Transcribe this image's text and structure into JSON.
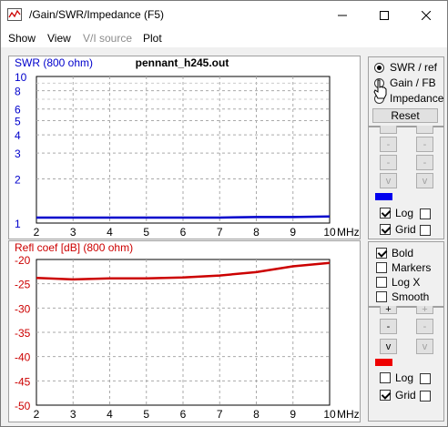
{
  "window": {
    "title": "/Gain/SWR/Impedance (F5)"
  },
  "titlebar_icons": {
    "minimize": "minimize-icon",
    "maximize": "maximize-icon",
    "close": "close-icon"
  },
  "menu": [
    "Show",
    "View",
    "V/I source",
    "Plot"
  ],
  "menu_disabled": [
    false,
    false,
    true,
    false
  ],
  "chart_top": {
    "file": "pennant_h245.out",
    "ylabel": "SWR (800 ohm)",
    "y_ticks": [
      "1",
      "2",
      "3",
      "4",
      "5",
      "6",
      "8",
      "10"
    ],
    "x_ticks": [
      "2",
      "3",
      "4",
      "5",
      "6",
      "7",
      "8",
      "9",
      "10"
    ],
    "x_unit": "MHz",
    "color": "#0000cc"
  },
  "chart_bottom": {
    "ylabel": "Refl coef [dB] (800 ohm)",
    "y_ticks": [
      "-20",
      "-25",
      "-30",
      "-35",
      "-40",
      "-45",
      "-50"
    ],
    "x_ticks": [
      "2",
      "3",
      "4",
      "5",
      "6",
      "7",
      "8",
      "9",
      "10"
    ],
    "x_unit": "MHz",
    "color": "#cc0000"
  },
  "chart_data": [
    {
      "type": "line",
      "title": "pennant_h245.out",
      "xlabel": "MHz",
      "ylabel": "SWR (800 ohm)",
      "xlim": [
        2,
        10
      ],
      "ylim": [
        1,
        10
      ],
      "y_scale": "log",
      "grid": true,
      "series": [
        {
          "x": [
            2,
            3,
            4,
            5,
            6,
            7,
            8,
            9,
            10
          ],
          "values": [
            1.09,
            1.09,
            1.09,
            1.09,
            1.09,
            1.09,
            1.1,
            1.1,
            1.11
          ]
        }
      ]
    },
    {
      "type": "line",
      "xlabel": "MHz",
      "ylabel": "Refl coef [dB] (800 ohm)",
      "xlim": [
        2,
        10
      ],
      "ylim": [
        -50,
        -20
      ],
      "grid": true,
      "series": [
        {
          "x": [
            2,
            3,
            4,
            5,
            6,
            7,
            8,
            9,
            10
          ],
          "values": [
            -23.8,
            -24.1,
            -23.9,
            -23.9,
            -23.7,
            -23.3,
            -22.6,
            -21.4,
            -20.7
          ]
        }
      ]
    }
  ],
  "side_top": {
    "radios": [
      {
        "label": "SWR / ref",
        "selected": true
      },
      {
        "label": "Gain / FB",
        "selected": false
      },
      {
        "label": "Impedance",
        "selected": false
      }
    ],
    "reset_label": "Reset",
    "buttons": [
      "-",
      "-",
      "-",
      "-",
      "v",
      "v"
    ],
    "swatch_color": "#0000ee",
    "log": {
      "label": "Log",
      "checked": true
    },
    "grid": {
      "label": "Grid",
      "checked": true
    }
  },
  "side_bottom": {
    "options": [
      {
        "label": "Bold",
        "checked": true
      },
      {
        "label": "Markers",
        "checked": false
      },
      {
        "label": "Log X",
        "checked": false
      },
      {
        "label": "Smooth",
        "checked": false
      }
    ],
    "buttons": [
      "+",
      "+",
      "-",
      "-",
      "v",
      "v"
    ],
    "swatch_color": "#ee0000",
    "log": {
      "label": "Log",
      "checked": false
    },
    "grid": {
      "label": "Grid",
      "checked": true
    }
  }
}
